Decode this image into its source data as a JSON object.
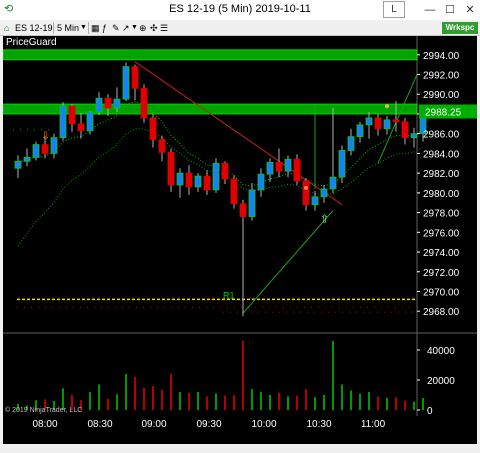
{
  "window": {
    "title": "ES 12-19 (5 Min)  2019-10-11",
    "l_button": "L",
    "minimize": "—",
    "maximize": "☐",
    "close": "✕"
  },
  "toolbar": {
    "instrument": "ES 12-19",
    "period": "5 Min",
    "workspace": "Wrkspc"
  },
  "indicator": {
    "name": "PriceGuard",
    "r1": "R1"
  },
  "copyright": "© 2019 NinjaTrader, LLC",
  "price_axis": {
    "ticks": [
      "2994.00",
      "2992.00",
      "2990.00",
      "2988.00",
      "2986.00",
      "2984.00",
      "2982.00",
      "2980.00",
      "2978.00",
      "2976.00",
      "2974.00",
      "2972.00",
      "2970.00",
      "2968.00"
    ],
    "last_price": "2988.25"
  },
  "volume_axis": {
    "ticks": [
      "40000",
      "20000",
      "0"
    ]
  },
  "time_axis": {
    "ticks": [
      "08:00",
      "08:30",
      "09:00",
      "09:30",
      "10:00",
      "10:30",
      "11:00"
    ]
  },
  "colors": {
    "up": "#1a7fff",
    "down": "#e00000",
    "bull_edge": "#00d000",
    "price_label": "#00b000",
    "level_line": "#ffd800"
  },
  "chart_data": {
    "type": "candlestick",
    "timeframe": "5 Min",
    "x": [
      "07:50",
      "07:55",
      "08:00",
      "08:05",
      "08:10",
      "08:15",
      "08:20",
      "08:25",
      "08:30",
      "08:35",
      "08:40",
      "08:45",
      "08:50",
      "08:55",
      "09:00",
      "09:05",
      "09:10",
      "09:15",
      "09:20",
      "09:25",
      "09:30",
      "09:35",
      "09:40",
      "09:45",
      "09:50",
      "09:55",
      "10:00",
      "10:05",
      "10:10",
      "10:15",
      "10:20",
      "10:25",
      "10:30",
      "10:35",
      "10:40",
      "10:45",
      "10:50",
      "10:55",
      "11:00",
      "11:05",
      "11:10",
      "11:15",
      "11:20",
      "11:25",
      "11:30",
      "11:35"
    ],
    "ohlc": [
      [
        2982.5,
        2983.8,
        2981.5,
        2983.2
      ],
      [
        2983.2,
        2984.5,
        2982.7,
        2983.6
      ],
      [
        2983.6,
        2985.2,
        2983.3,
        2984.9
      ],
      [
        2984.9,
        2985.8,
        2983.5,
        2984.0
      ],
      [
        2984.0,
        2986.0,
        2983.5,
        2985.6
      ],
      [
        2985.6,
        2989.2,
        2985.3,
        2988.8
      ],
      [
        2988.8,
        2989.0,
        2986.2,
        2987.0
      ],
      [
        2987.0,
        2988.1,
        2985.5,
        2986.3
      ],
      [
        2986.3,
        2988.3,
        2985.9,
        2988.2
      ],
      [
        2988.2,
        2990.2,
        2987.9,
        2989.6
      ],
      [
        2989.6,
        2990.0,
        2987.8,
        2988.6
      ],
      [
        2988.6,
        2990.7,
        2988.2,
        2989.5
      ],
      [
        2989.5,
        2993.2,
        2989.3,
        2992.8
      ],
      [
        2992.8,
        2993.0,
        2989.4,
        2990.6
      ],
      [
        2990.6,
        2991.0,
        2987.1,
        2987.6
      ],
      [
        2987.6,
        2988.0,
        2984.6,
        2985.4
      ],
      [
        2985.4,
        2985.8,
        2983.2,
        2984.1
      ],
      [
        2984.1,
        2984.5,
        2980.1,
        2980.8
      ],
      [
        2980.8,
        2982.5,
        2979.5,
        2982.0
      ],
      [
        2982.0,
        2982.8,
        2979.8,
        2980.6
      ],
      [
        2980.6,
        2982.0,
        2980.1,
        2981.7
      ],
      [
        2981.7,
        2982.3,
        2979.8,
        2980.3
      ],
      [
        2980.3,
        2983.5,
        2980.0,
        2983.0
      ],
      [
        2983.0,
        2983.2,
        2980.9,
        2981.4
      ],
      [
        2981.4,
        2981.8,
        2978.4,
        2978.9
      ],
      [
        2978.9,
        2979.3,
        2967.5,
        2977.6
      ],
      [
        2977.6,
        2981.0,
        2977.2,
        2980.3
      ],
      [
        2980.3,
        2982.5,
        2979.6,
        2981.9
      ],
      [
        2981.9,
        2983.5,
        2981.1,
        2983.1
      ],
      [
        2983.1,
        2984.5,
        2981.6,
        2982.2
      ],
      [
        2982.2,
        2983.8,
        2981.6,
        2983.4
      ],
      [
        2983.4,
        2983.9,
        2980.8,
        2981.2
      ],
      [
        2981.2,
        2981.5,
        2978.2,
        2978.8
      ],
      [
        2978.8,
        2980.2,
        2978.2,
        2979.6
      ],
      [
        2979.6,
        2980.8,
        2979.0,
        2980.4
      ],
      [
        2980.4,
        2988.6,
        2980.0,
        2981.6
      ],
      [
        2981.6,
        2984.8,
        2981.0,
        2984.3
      ],
      [
        2984.3,
        2986.5,
        2983.8,
        2985.7
      ],
      [
        2985.7,
        2987.2,
        2985.1,
        2986.9
      ],
      [
        2986.9,
        2988.2,
        2985.5,
        2987.6
      ],
      [
        2987.6,
        2988.0,
        2985.8,
        2986.5
      ],
      [
        2986.5,
        2987.8,
        2985.9,
        2987.4
      ],
      [
        2987.4,
        2989.3,
        2986.2,
        2987.2
      ],
      [
        2987.2,
        2987.6,
        2984.9,
        2985.6
      ],
      [
        2985.6,
        2986.6,
        2984.6,
        2986.0
      ],
      [
        2986.0,
        2987.8,
        2985.2,
        2988.25
      ]
    ],
    "volume": [
      4000,
      3000,
      6500,
      7000,
      6000,
      14500,
      10000,
      6500,
      12000,
      17000,
      7500,
      10500,
      24000,
      22000,
      15000,
      16000,
      13500,
      24000,
      12000,
      11500,
      12000,
      9000,
      11000,
      9500,
      10000,
      46000,
      14000,
      12000,
      10000,
      11500,
      9000,
      9500,
      14000,
      8500,
      10000,
      46000,
      17000,
      13000,
      11000,
      12000,
      9000,
      8000,
      8500,
      6000,
      5500,
      8000
    ],
    "ylim": [
      2966.5,
      2995.5
    ],
    "volume_ylim": [
      0,
      48000
    ],
    "bands": [
      [
        2993.5,
        2994.5
      ],
      [
        2988.0,
        2989.0
      ]
    ],
    "level_line": 2969.2
  }
}
